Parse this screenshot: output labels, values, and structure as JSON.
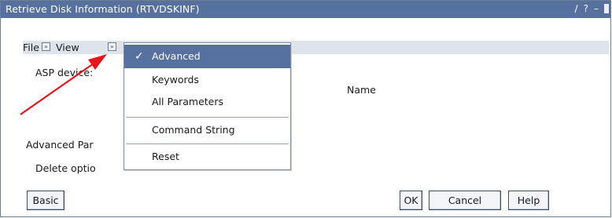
{
  "window": {
    "title": "Retrieve Disk Information (RTVDSKINF)"
  },
  "titlebar_icons": [
    {
      "name": "edit-icon",
      "glyph": "∕"
    },
    {
      "name": "help-icon",
      "glyph": "?"
    },
    {
      "name": "minimize-icon",
      "glyph": "–"
    }
  ],
  "menubar": {
    "file_label": "File",
    "view_label": "View"
  },
  "form": {
    "asp_device_label": "ASP device:",
    "name_column_header": "Name",
    "advanced_section_label": "Advanced Par",
    "delete_option_label": "Delete optio"
  },
  "view_menu": {
    "items": [
      {
        "label": "Advanced",
        "checked": true
      },
      {
        "label": "Keywords",
        "checked": false
      },
      {
        "label": "All Parameters",
        "checked": false
      },
      {
        "label": "Command String",
        "checked": false
      },
      {
        "label": "Reset",
        "checked": false
      }
    ]
  },
  "buttons": {
    "basic": "Basic",
    "ok": "OK",
    "cancel": "Cancel",
    "help": "Help"
  },
  "colors": {
    "titlebar": "#56719f",
    "menu_highlight": "#56719f",
    "menubar_background": "#dfe3ea",
    "annotation_arrow": "#e8141b"
  }
}
